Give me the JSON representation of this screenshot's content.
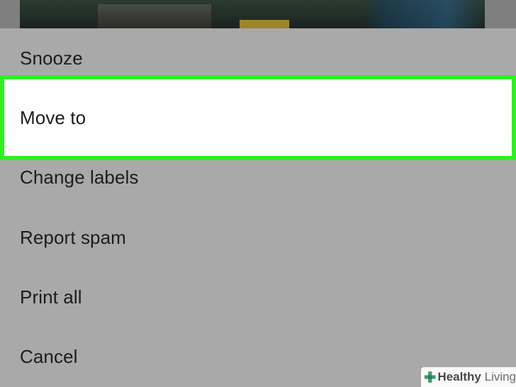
{
  "menu": {
    "items": [
      {
        "label": "Snooze"
      },
      {
        "label": "Move to"
      },
      {
        "label": "Change labels"
      },
      {
        "label": "Report spam"
      },
      {
        "label": "Print all"
      },
      {
        "label": "Cancel"
      }
    ],
    "highlighted_item": "Move to"
  },
  "watermark": {
    "brand_bold": "Healthy",
    "brand_light": "Living",
    "icon": "plus-cross-icon"
  },
  "colors": {
    "sheet_background": "#a9a9a9",
    "highlight_border": "#2fef23",
    "highlight_background": "#ffffff",
    "text": "#1c1c1c"
  }
}
